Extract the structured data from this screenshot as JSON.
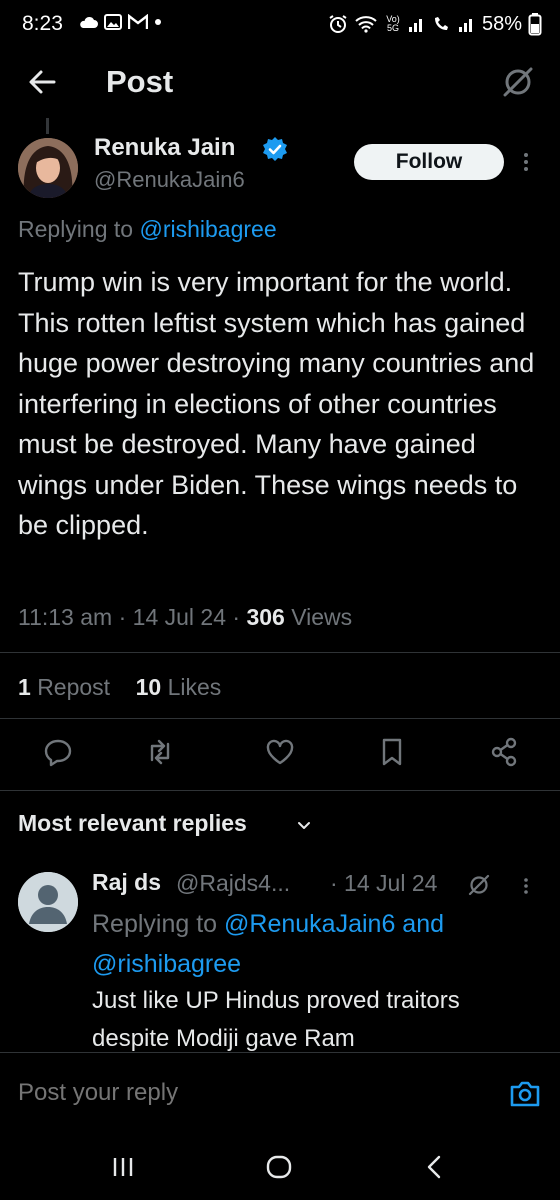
{
  "status_bar": {
    "time": "8:23",
    "battery": "58%",
    "network": "Vo) 5G"
  },
  "header": {
    "title": "Post"
  },
  "post": {
    "author_name": "Renuka Jain",
    "author_handle": "@RenukaJain6",
    "follow_label": "Follow",
    "replying_prefix": "Replying to ",
    "replying_to": "@rishibagree",
    "text": "Trump win is very important for the world. This rotten leftist system which has gained huge power destroying many countries and interfering in elections of other countries must be destroyed. Many have gained wings under Biden. These wings needs to be clipped.",
    "time": "11:13 am",
    "date": "14 Jul 24",
    "views_count": "306",
    "views_label": "Views",
    "reposts_count": "1",
    "reposts_label": "Repost",
    "likes_count": "10",
    "likes_label": "Likes"
  },
  "replies": {
    "sort_label": "Most relevant replies",
    "items": [
      {
        "name": "Raj ds",
        "handle": "@Rajds4...",
        "date": "· 14 Jul 24",
        "replying_prefix": "Replying to ",
        "replying_to_1": "@RenukaJain6",
        "replying_and": " and",
        "replying_to_2": "@rishibagree",
        "text": "Just like UP Hindus proved traitors despite Modiji gave Ram"
      }
    ]
  },
  "composer": {
    "placeholder": "Post your reply"
  },
  "colors": {
    "background": "#000000",
    "accent": "#1d9bf0",
    "muted": "#71767b",
    "text": "#e7e9ea",
    "verified": "#1d9bf0"
  }
}
